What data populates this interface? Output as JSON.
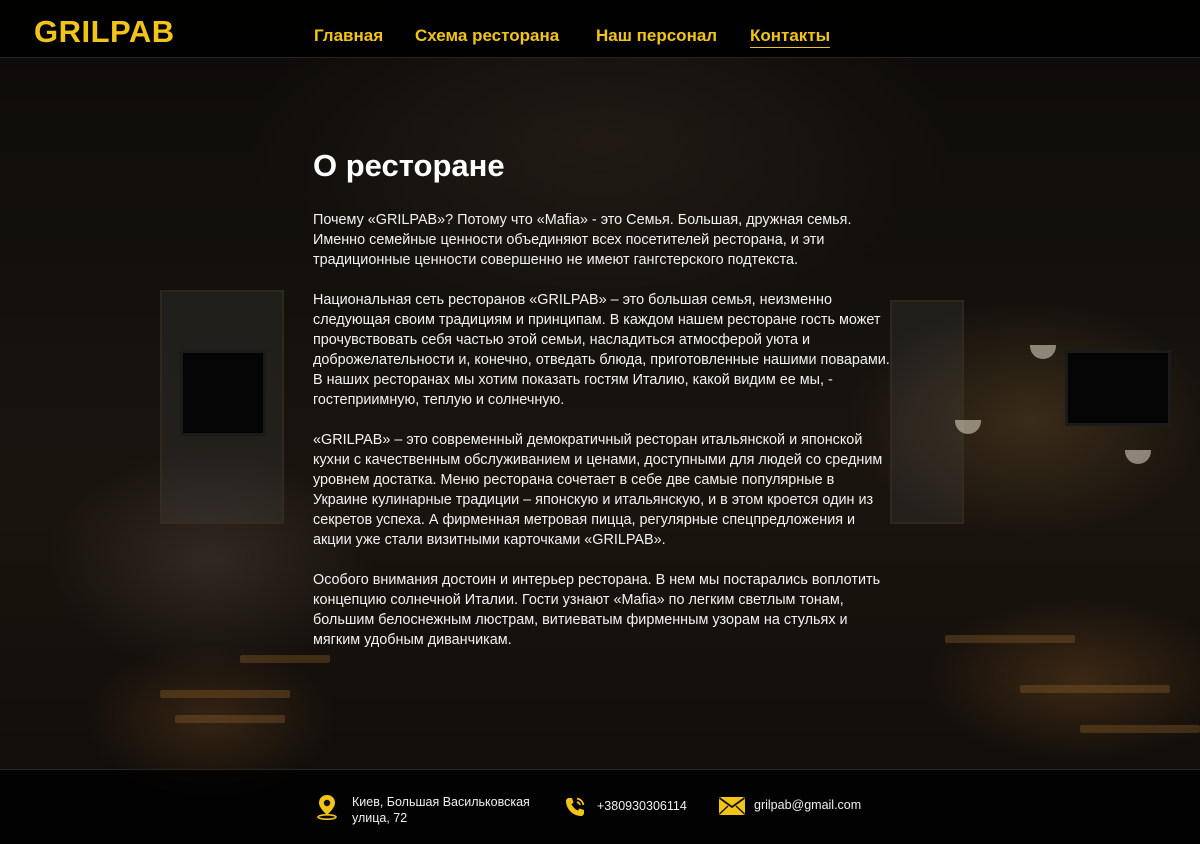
{
  "brand": {
    "logo": "GRILPAB",
    "accent_color": "#f2c418"
  },
  "nav": {
    "items": [
      {
        "label": "Главная"
      },
      {
        "label": "Схема ресторана"
      },
      {
        "label": "Наш персонал"
      },
      {
        "label": "Контакты"
      }
    ],
    "active": "Контакты"
  },
  "about": {
    "title": "О ресторане",
    "paragraphs": [
      "Почему «GRILPAB»? Потому что «Mafia» - это Семья. Большая, дружная семья. Именно семейные ценности объединяют всех посетителей ресторана,  и эти традиционные ценности совершенно не имеют  гангстерского подтекста.",
      "Национальная сеть ресторанов «GRILPAB» – это большая семья, неизменно следующая своим традициям и принципам. В каждом нашем ресторане гость может прочувствовать себя частью этой семьи, насладиться атмосферой уюта и доброжелательности и, конечно, отведать блюда, приготовленные нашими поварами. В наших ресторанах мы хотим показать гостям Италию, какой видим ее мы, - гостеприимную, теплую и солнечную.",
      "«GRILPAB» – это современный демократичный ресторан итальянской и японской кухни с качественным обслуживанием и ценами, доступными для людей со средним уровнем достатка. Меню ресторана сочетает в себе две самые популярные в Украине кулинарные традиции – японскую и итальянскую, и в этом кроется один из секретов успеха. А фирменная метровая пицца, регулярные спецпредложения и акции уже стали визитными карточками «GRILPAB».",
      "Особого внимания достоин и интерьер ресторана. В нем мы постарались воплотить концепцию солнечной Италии. Гости узнают «Mafia» по легким светлым тонам, большим белоснежным люстрам, витиеватым фирменным узорам на стульях и мягким удобным диванчикам."
    ]
  },
  "footer": {
    "address_line1": "Киев, Большая Васильковская",
    "address_line2": "улица, 72",
    "address_icon": "map-pin-icon",
    "phone": "+380930306114",
    "phone_icon": "phone-icon",
    "email": "grilpab@gmail.com",
    "email_icon": "envelope-icon"
  }
}
